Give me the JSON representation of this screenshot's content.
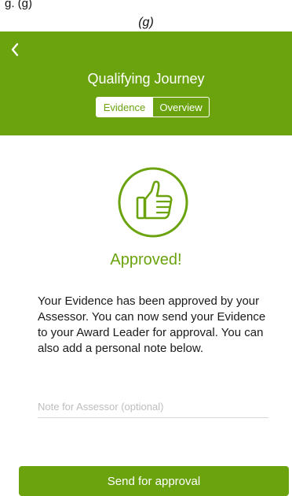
{
  "caption": {
    "partial_text": "g. (g)",
    "label": "(g)"
  },
  "header": {
    "back_icon": "chevron-left-icon",
    "title": "Qualifying Journey",
    "tabs": [
      {
        "label": "Evidence",
        "selected": true
      },
      {
        "label": "Overview",
        "selected": false
      }
    ]
  },
  "status": {
    "icon": "thumbs-up-icon",
    "title": "Approved!",
    "message": "Your Evidence has been approved by your Assessor. You can now send your Evidence to your Award Leader for approval. You can also add a personal note below."
  },
  "note": {
    "value": "",
    "placeholder": "Note for Assessor (optional)"
  },
  "actions": {
    "send_label": "Send for approval"
  },
  "colors": {
    "brand_green": "#6aa30d",
    "text": "#1a1a1a",
    "placeholder": "#bdbdbd",
    "background": "#ffffff"
  }
}
